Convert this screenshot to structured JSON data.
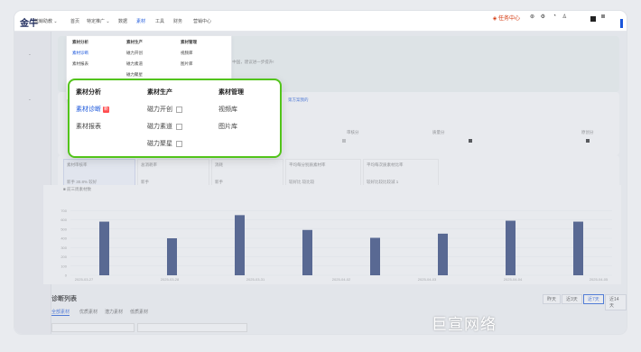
{
  "nav": {
    "logo": "金牛",
    "account": "蓝鲸助教 ⌄",
    "items": [
      "首页",
      "特定推广 ⌄",
      "数据",
      "素材",
      "工具",
      "财务",
      "营销中心"
    ],
    "active_index": 3,
    "right_label": "任务中心",
    "right_icons": [
      "bell-icon",
      "settings-icon",
      "notification-icon",
      "user-icon"
    ]
  },
  "mini_menu": {
    "headers": [
      "素材分析",
      "素材生产",
      "素材管理"
    ],
    "col1": [
      "素材诊断",
      "素材报表"
    ],
    "col2": [
      "磁力开创",
      "磁力素道",
      "磁力聚星"
    ],
    "col3": [
      "视频库",
      "图片库"
    ]
  },
  "popup": {
    "headers": [
      "素材分析",
      "素材生产",
      "素材管理"
    ],
    "analysis": [
      {
        "label": "素材诊断",
        "active": true,
        "badge": "新"
      },
      {
        "label": "素材报表",
        "active": false
      }
    ],
    "production": [
      {
        "label": "磁力开创",
        "external": true
      },
      {
        "label": "磁力素道",
        "external": true
      },
      {
        "label": "磁力聚星",
        "external": true
      }
    ],
    "management": [
      "视频库",
      "图片库"
    ]
  },
  "banner": {
    "text": "门\"审核分\"中国，建议进一步提升!",
    "link": "第方案我的"
  },
  "metrics": {
    "labels": [
      "审核分",
      "质量分",
      "原创分"
    ]
  },
  "stat_cards": {
    "labels": [
      "素材审核率",
      "总消耗率",
      "消耗",
      "平均每分别质素材率",
      "平均每次质素材比率"
    ],
    "sub": [
      "新手 30.8% 较好",
      "新手",
      "新手",
      "较好比 较比较",
      "较好比较比较减 1"
    ]
  },
  "chart_data": {
    "type": "bar",
    "legend": [
      "前三周素材数"
    ],
    "x": [
      "2025-03-27",
      "2025-03-28",
      "2025-03-31",
      "2025-04-01",
      "2025-04-02",
      "2025-04-03",
      "2025-04-04",
      "2025-04-05"
    ],
    "x_tick_labels": [
      "2025-03-27",
      "2025-03-28",
      "2025-03-31",
      "2025-04-02",
      "2025-04-03",
      "2025-04-04",
      "2025-04-05"
    ],
    "series": [
      {
        "name": "前三周素材数",
        "values": [
          580,
          400,
          650,
          490,
          405,
          450,
          590,
          580
        ]
      }
    ],
    "y_ticks": [
      0,
      100,
      200,
      300,
      400,
      500,
      600,
      700
    ],
    "ylim": [
      0,
      800
    ],
    "colors": {
      "bar": "#243a73"
    }
  },
  "list": {
    "title": "诊断列表",
    "tabs": [
      "全部素材",
      "优质素材",
      "潜力素材",
      "低质素材"
    ],
    "active_tab": 0,
    "range_buttons": [
      "昨天",
      "近3天",
      "近7天",
      "近14天"
    ],
    "active_range": 2
  },
  "watermark": "巨宣网络",
  "colors": {
    "accent": "#1a56db",
    "popup_border": "#52c41a",
    "bar": "#243a73"
  }
}
